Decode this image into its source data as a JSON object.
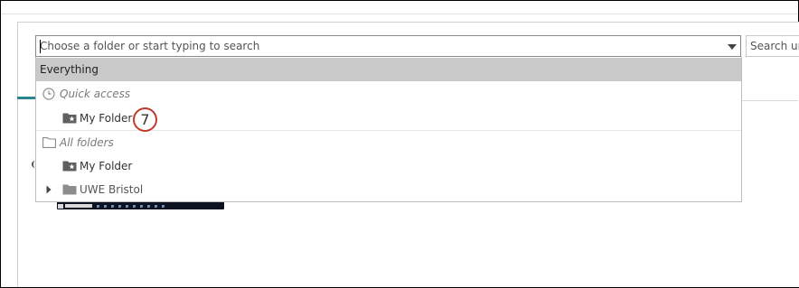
{
  "folder_picker": {
    "placeholder": "Choose a folder or start typing to search",
    "value": "",
    "caret_icon": "chevron-down-icon"
  },
  "search": {
    "placeholder": "Search un"
  },
  "menu": {
    "everything_label": "Everything",
    "quick_access": {
      "label": "Quick access",
      "icon": "clock-icon",
      "items": [
        {
          "label": "My Folder",
          "icon": "folder-star-icon"
        }
      ]
    },
    "all_folders": {
      "label": "All folders",
      "icon": "folder-outline-icon",
      "items": [
        {
          "label": "My Folder",
          "icon": "folder-star-icon"
        },
        {
          "label": "UWE Bristol",
          "icon": "folder-icon",
          "expander": "caret-right-icon"
        }
      ]
    }
  },
  "annotation": {
    "callout_number": "7",
    "callout_color": "#c0392b"
  },
  "colors": {
    "accent_teal": "#2b8290",
    "highlight_row": "#c9c9c9"
  }
}
